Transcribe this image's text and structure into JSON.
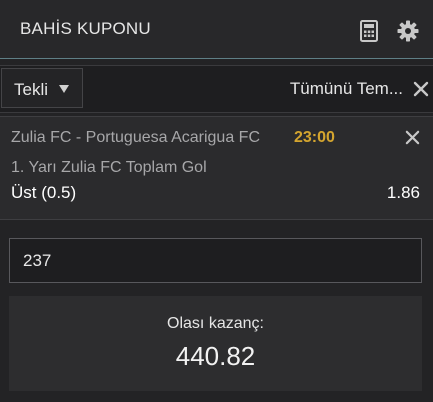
{
  "header": {
    "title": "BAHİS KUPONU",
    "icons": [
      "calculator-icon",
      "gear-icon"
    ]
  },
  "toolbar": {
    "bet_type": "Tekli",
    "clear_all_label": "Tümünü Tem..."
  },
  "selection": {
    "match": "Zulia FC - Portuguesa Acarigua FC",
    "kickoff": "23:00",
    "market": "1. Yarı Zulia FC Toplam Gol",
    "outcome": "Üst (0.5)",
    "odds": "1.86"
  },
  "stake": {
    "value": "237"
  },
  "winnings": {
    "label": "Olası kazanç:",
    "value": "440.82"
  },
  "colors": {
    "accent_time": "#d4a52f",
    "background": "#232325",
    "header_divider": "#5f7f86"
  }
}
